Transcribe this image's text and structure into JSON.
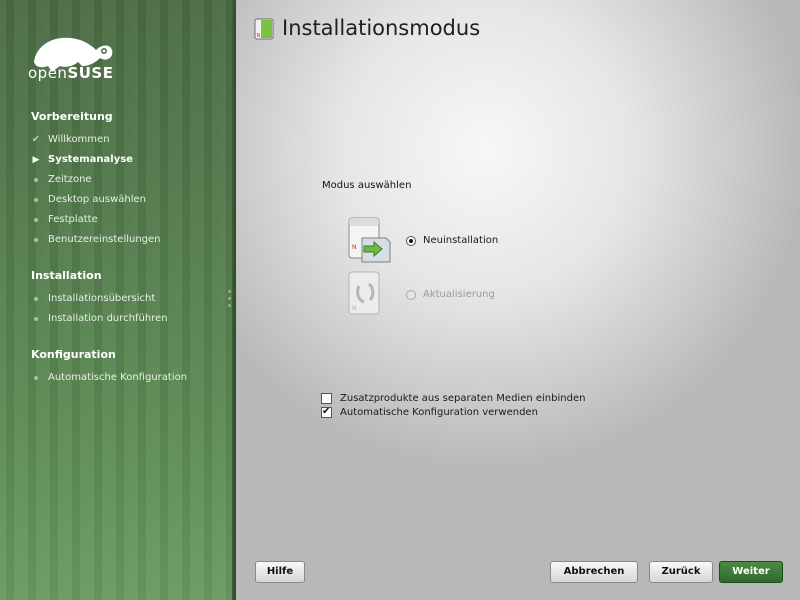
{
  "sidebar": {
    "brand": {
      "prefix": "open",
      "name": "SUSE"
    },
    "sections": [
      {
        "title": "Vorbereitung",
        "steps": [
          {
            "label": "Willkommen",
            "state": "done"
          },
          {
            "label": "Systemanalyse",
            "state": "current"
          },
          {
            "label": "Zeitzone",
            "state": "pending"
          },
          {
            "label": "Desktop auswählen",
            "state": "pending"
          },
          {
            "label": "Festplatte",
            "state": "pending"
          },
          {
            "label": "Benutzereinstellungen",
            "state": "pending"
          }
        ]
      },
      {
        "title": "Installation",
        "steps": [
          {
            "label": "Installationsübersicht",
            "state": "pending"
          },
          {
            "label": "Installation durchführen",
            "state": "pending"
          }
        ]
      },
      {
        "title": "Konfiguration",
        "steps": [
          {
            "label": "Automatische Konfiguration",
            "state": "pending"
          }
        ]
      }
    ]
  },
  "main": {
    "title": "Installationsmodus",
    "mode_group_label": "Modus auswählen",
    "modes": [
      {
        "label": "Neuinstallation",
        "selected": true,
        "enabled": true
      },
      {
        "label": "Aktualisierung",
        "selected": false,
        "enabled": false
      }
    ],
    "options": [
      {
        "label": "Zusatzprodukte aus separaten Medien einbinden",
        "checked": false
      },
      {
        "label": "Automatische Konfiguration verwenden",
        "checked": true
      }
    ]
  },
  "buttons": {
    "help": "Hilfe",
    "abort": "Abbrechen",
    "back": "Zurück",
    "next": "Weiter"
  },
  "colors": {
    "sidebar": "#537a4c",
    "primary_button": "#2e6a2a",
    "accent_green": "#73b341"
  }
}
